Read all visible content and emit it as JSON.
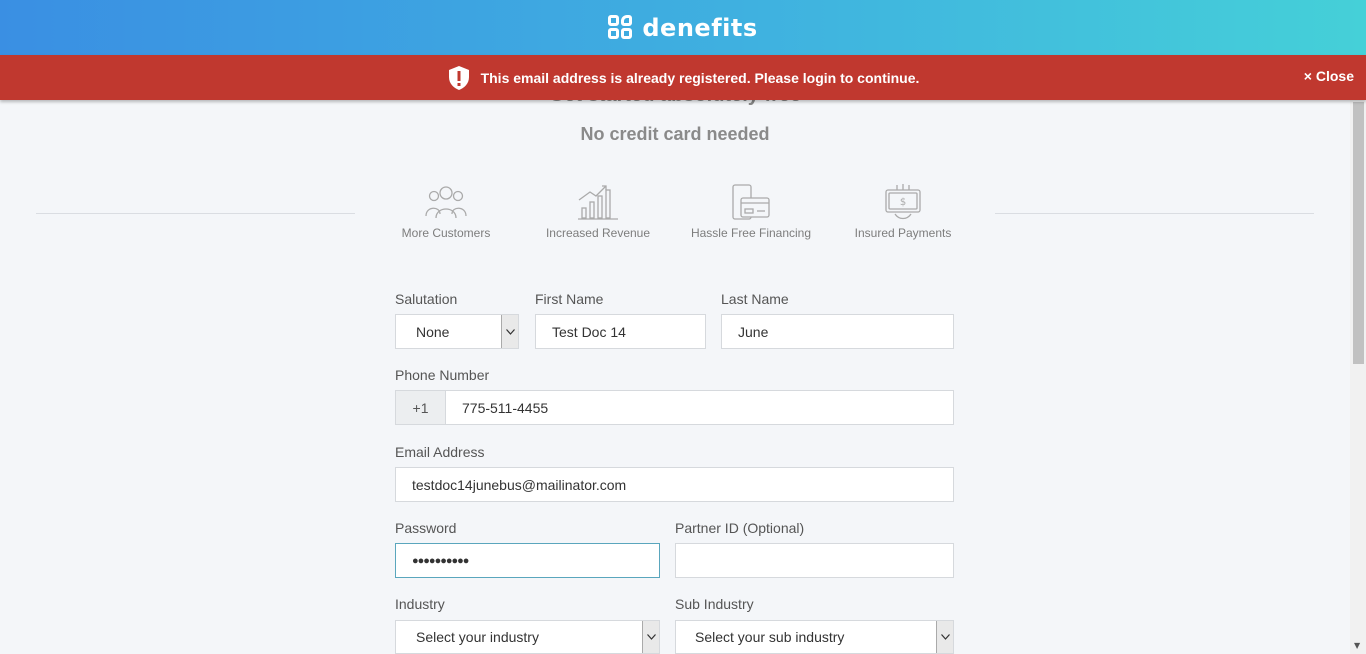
{
  "header": {
    "brand": "denefits"
  },
  "alert": {
    "message": "This email address is already registered. Please login to continue.",
    "close_label": "× Close",
    "color": "#c0382f"
  },
  "page": {
    "heading": "Get started absolutely free",
    "subheading": "No credit card needed"
  },
  "features": [
    {
      "label": "More Customers",
      "icon": "customers-icon"
    },
    {
      "label": "Increased Revenue",
      "icon": "revenue-chart-icon"
    },
    {
      "label": "Hassle Free Financing",
      "icon": "financing-card-icon"
    },
    {
      "label": "Insured Payments",
      "icon": "insured-payment-icon"
    }
  ],
  "form": {
    "salutation": {
      "label": "Salutation",
      "value": "None"
    },
    "first_name": {
      "label": "First Name",
      "value": "Test Doc 14"
    },
    "last_name": {
      "label": "Last Name",
      "value": "June"
    },
    "phone": {
      "label": "Phone Number",
      "prefix": "+1",
      "value": "775-511-4455"
    },
    "email": {
      "label": "Email Address",
      "value": "testdoc14junebus@mailinator.com"
    },
    "password": {
      "label": "Password",
      "value": "●●●●●●●●●●"
    },
    "partner_id": {
      "label": "Partner ID (Optional)",
      "value": ""
    },
    "industry": {
      "label": "Industry",
      "value": "Select your industry"
    },
    "sub_industry": {
      "label": "Sub Industry",
      "value": "Select your sub industry"
    }
  }
}
